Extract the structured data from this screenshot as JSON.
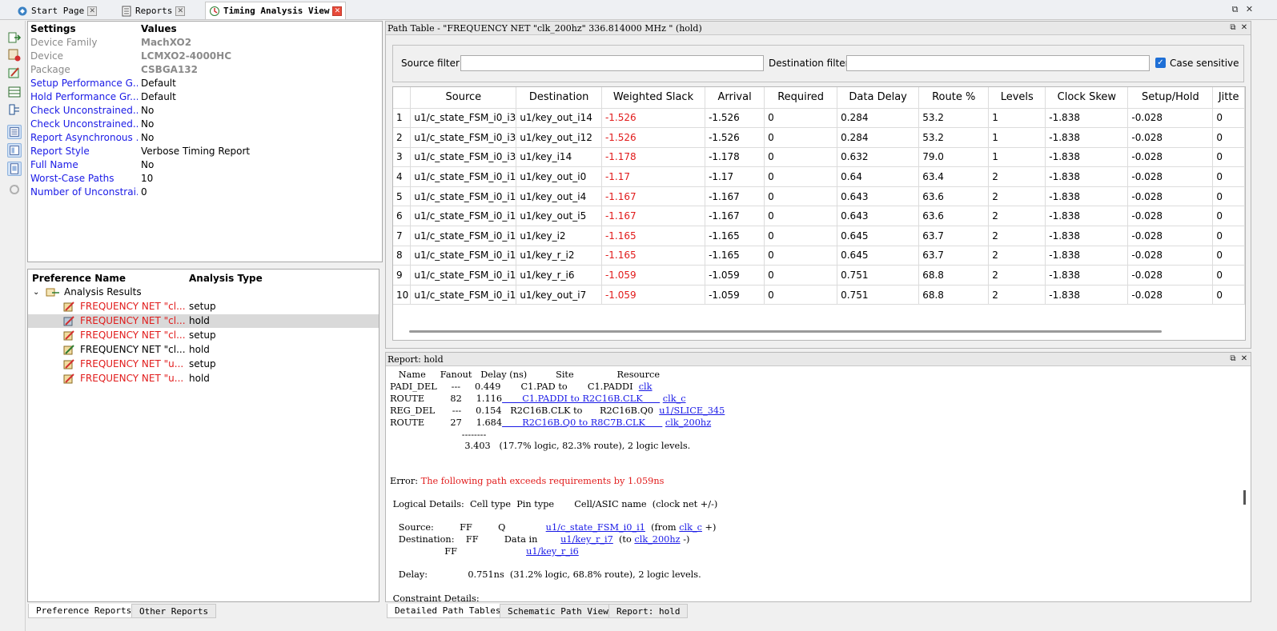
{
  "top_tabs": [
    {
      "label": "Start Page",
      "icon": "start-page-icon"
    },
    {
      "label": "Reports",
      "icon": "reports-icon"
    },
    {
      "label": "Timing Analysis View",
      "icon": "timing-analysis-icon"
    }
  ],
  "window_controls": {
    "restore": "⧉",
    "close": "✕"
  },
  "settings": {
    "headers": {
      "settings": "Settings",
      "values": "Values"
    },
    "rows": [
      {
        "key": "Device Family",
        "value": "MachXO2"
      },
      {
        "key": "Device",
        "value": "LCMXO2-4000HC"
      },
      {
        "key": "Package",
        "value": "CSBGA132"
      },
      {
        "key": "Setup Performance G...",
        "value": "Default"
      },
      {
        "key": "Hold Performance Gr...",
        "value": "Default"
      },
      {
        "key": "Check Unconstrained...",
        "value": "No"
      },
      {
        "key": "Check Unconstrained...",
        "value": "No"
      },
      {
        "key": "Report Asynchronous ...",
        "value": "No"
      },
      {
        "key": "Report Style",
        "value": "Verbose Timing Report"
      },
      {
        "key": "Full Name",
        "value": "No"
      },
      {
        "key": "Worst-Case Paths",
        "value": "10"
      },
      {
        "key": "Number of Unconstrai...",
        "value": "0"
      }
    ]
  },
  "preferences": {
    "headers": {
      "name": "Preference Name",
      "type": "Analysis Type"
    },
    "root": "Analysis Results",
    "items": [
      {
        "name": "FREQUENCY NET \"cl...",
        "type": "setup",
        "error": true
      },
      {
        "name": "FREQUENCY NET \"cl...",
        "type": "hold",
        "error": true
      },
      {
        "name": "FREQUENCY NET \"cl...",
        "type": "setup",
        "error": true
      },
      {
        "name": "FREQUENCY NET \"cl...",
        "type": "hold",
        "error": false
      },
      {
        "name": "FREQUENCY NET \"u...",
        "type": "setup",
        "error": true
      },
      {
        "name": "FREQUENCY NET \"u...",
        "type": "hold",
        "error": true
      }
    ]
  },
  "left_bottom_tabs": [
    "Preference Reports",
    "Other Reports"
  ],
  "path_table": {
    "title": "Path Table - \"FREQUENCY NET \"clk_200hz\" 336.814000 MHz \" (hold)",
    "source_filter_label": "Source filter:",
    "destination_filter_label": "Destination filter:",
    "case_sensitive_label": "Case sensitive",
    "columns": [
      "",
      "Source",
      "Destination",
      "Weighted Slack",
      "Arrival",
      "Required",
      "Data Delay",
      "Route %",
      "Levels",
      "Clock Skew",
      "Setup/Hold",
      "Jitte"
    ],
    "rows": [
      [
        "1",
        "u1/c_state_FSM_i0_i3",
        "u1/key_out_i14",
        "-1.526",
        "-1.526",
        "0",
        "0.284",
        "53.2",
        "1",
        "-1.838",
        "-0.028",
        "0"
      ],
      [
        "2",
        "u1/c_state_FSM_i0_i3",
        "u1/key_out_i12",
        "-1.526",
        "-1.526",
        "0",
        "0.284",
        "53.2",
        "1",
        "-1.838",
        "-0.028",
        "0"
      ],
      [
        "3",
        "u1/c_state_FSM_i0_i3",
        "u1/key_i14",
        "-1.178",
        "-1.178",
        "0",
        "0.632",
        "79.0",
        "1",
        "-1.838",
        "-0.028",
        "0"
      ],
      [
        "4",
        "u1/c_state_FSM_i0_i1",
        "u1/key_out_i0",
        "-1.17",
        "-1.17",
        "0",
        "0.64",
        "63.4",
        "2",
        "-1.838",
        "-0.028",
        "0"
      ],
      [
        "5",
        "u1/c_state_FSM_i0_i1",
        "u1/key_out_i4",
        "-1.167",
        "-1.167",
        "0",
        "0.643",
        "63.6",
        "2",
        "-1.838",
        "-0.028",
        "0"
      ],
      [
        "6",
        "u1/c_state_FSM_i0_i1",
        "u1/key_out_i5",
        "-1.167",
        "-1.167",
        "0",
        "0.643",
        "63.6",
        "2",
        "-1.838",
        "-0.028",
        "0"
      ],
      [
        "7",
        "u1/c_state_FSM_i0_i1",
        "u1/key_i2",
        "-1.165",
        "-1.165",
        "0",
        "0.645",
        "63.7",
        "2",
        "-1.838",
        "-0.028",
        "0"
      ],
      [
        "8",
        "u1/c_state_FSM_i0_i1",
        "u1/key_r_i2",
        "-1.165",
        "-1.165",
        "0",
        "0.645",
        "63.7",
        "2",
        "-1.838",
        "-0.028",
        "0"
      ],
      [
        "9",
        "u1/c_state_FSM_i0_i1",
        "u1/key_r_i6",
        "-1.059",
        "-1.059",
        "0",
        "0.751",
        "68.8",
        "2",
        "-1.838",
        "-0.028",
        "0"
      ],
      [
        "10",
        "u1/c_state_FSM_i0_i1",
        "u1/key_out_i7",
        "-1.059",
        "-1.059",
        "0",
        "0.751",
        "68.8",
        "2",
        "-1.838",
        "-0.028",
        "0"
      ]
    ]
  },
  "report": {
    "title": "Report: hold",
    "header_line": "   Name     Fanout   Delay (ns)          Site               Resource",
    "delay_rows": [
      {
        "name": "PADI_DEL",
        "fanout": "---",
        "delay": "0.449",
        "site": "       C1.PAD to       C1.PADDI ",
        "resource": "clk",
        "site_link": false
      },
      {
        "name": "ROUTE",
        "fanout": "82",
        "delay": "1.116",
        "site": "       C1.PADDI to R2C16B.CLK      ",
        "resource": "clk_c",
        "site_link": true
      },
      {
        "name": "REG_DEL",
        "fanout": "---",
        "delay": "0.154",
        "site": "   R2C16B.CLK to      R2C16B.Q0 ",
        "resource": "u1/SLICE_345",
        "site_link": false
      },
      {
        "name": "ROUTE",
        "fanout": "27",
        "delay": "1.684",
        "site": "       R2C16B.Q0 to R8C7B.CLK      ",
        "resource": "clk_200hz",
        "site_link": true
      }
    ],
    "sum_rule": "                         --------",
    "sum_line": "                          3.403   (17.7% logic, 82.3% route), 2 logic levels.",
    "error_prefix": "Error: ",
    "error_text": "The following path exceeds requirements by 1.059ns",
    "logical_header": " Logical Details:  Cell type  Pin type       Cell/ASIC name  (clock net +/-)",
    "source_label": "   Source:         FF         Q              ",
    "source_cell": "u1/c_state_FSM_i0_i1",
    "source_from": "  (from ",
    "source_clk": "clk_c",
    "source_end": " +)",
    "dest_label": "   Destination:    FF         Data in        ",
    "dest_cell": "u1/key_r_i7",
    "dest_to": "  (to ",
    "dest_clk": "clk_200hz",
    "dest_end": " -)",
    "dest2_label": "                   FF                        ",
    "dest2_cell": "u1/key_r_i6",
    "delay_line": "   Delay:              0.751ns  (31.2% logic, 68.8% route), 2 logic levels.",
    "constraint_line": " Constraint Details:"
  },
  "right_bottom_tabs": [
    "Detailed Path Tables",
    "Schematic Path View",
    "Report: hold"
  ]
}
